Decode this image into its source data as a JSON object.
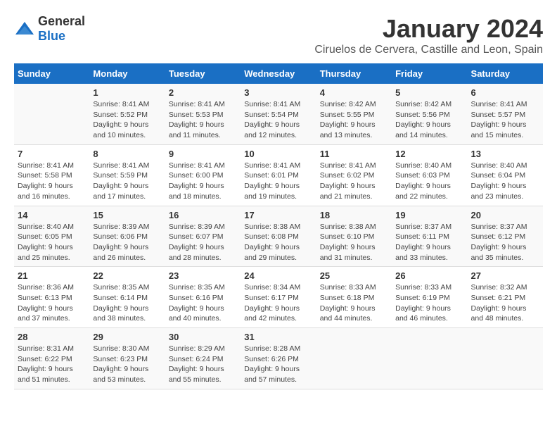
{
  "header": {
    "logo_general": "General",
    "logo_blue": "Blue",
    "month_title": "January 2024",
    "location": "Ciruelos de Cervera, Castille and Leon, Spain"
  },
  "weekdays": [
    "Sunday",
    "Monday",
    "Tuesday",
    "Wednesday",
    "Thursday",
    "Friday",
    "Saturday"
  ],
  "weeks": [
    [
      {
        "day": "",
        "info": ""
      },
      {
        "day": "1",
        "info": "Sunrise: 8:41 AM\nSunset: 5:52 PM\nDaylight: 9 hours\nand 10 minutes."
      },
      {
        "day": "2",
        "info": "Sunrise: 8:41 AM\nSunset: 5:53 PM\nDaylight: 9 hours\nand 11 minutes."
      },
      {
        "day": "3",
        "info": "Sunrise: 8:41 AM\nSunset: 5:54 PM\nDaylight: 9 hours\nand 12 minutes."
      },
      {
        "day": "4",
        "info": "Sunrise: 8:42 AM\nSunset: 5:55 PM\nDaylight: 9 hours\nand 13 minutes."
      },
      {
        "day": "5",
        "info": "Sunrise: 8:42 AM\nSunset: 5:56 PM\nDaylight: 9 hours\nand 14 minutes."
      },
      {
        "day": "6",
        "info": "Sunrise: 8:41 AM\nSunset: 5:57 PM\nDaylight: 9 hours\nand 15 minutes."
      }
    ],
    [
      {
        "day": "7",
        "info": "Sunrise: 8:41 AM\nSunset: 5:58 PM\nDaylight: 9 hours\nand 16 minutes."
      },
      {
        "day": "8",
        "info": "Sunrise: 8:41 AM\nSunset: 5:59 PM\nDaylight: 9 hours\nand 17 minutes."
      },
      {
        "day": "9",
        "info": "Sunrise: 8:41 AM\nSunset: 6:00 PM\nDaylight: 9 hours\nand 18 minutes."
      },
      {
        "day": "10",
        "info": "Sunrise: 8:41 AM\nSunset: 6:01 PM\nDaylight: 9 hours\nand 19 minutes."
      },
      {
        "day": "11",
        "info": "Sunrise: 8:41 AM\nSunset: 6:02 PM\nDaylight: 9 hours\nand 21 minutes."
      },
      {
        "day": "12",
        "info": "Sunrise: 8:40 AM\nSunset: 6:03 PM\nDaylight: 9 hours\nand 22 minutes."
      },
      {
        "day": "13",
        "info": "Sunrise: 8:40 AM\nSunset: 6:04 PM\nDaylight: 9 hours\nand 23 minutes."
      }
    ],
    [
      {
        "day": "14",
        "info": "Sunrise: 8:40 AM\nSunset: 6:05 PM\nDaylight: 9 hours\nand 25 minutes."
      },
      {
        "day": "15",
        "info": "Sunrise: 8:39 AM\nSunset: 6:06 PM\nDaylight: 9 hours\nand 26 minutes."
      },
      {
        "day": "16",
        "info": "Sunrise: 8:39 AM\nSunset: 6:07 PM\nDaylight: 9 hours\nand 28 minutes."
      },
      {
        "day": "17",
        "info": "Sunrise: 8:38 AM\nSunset: 6:08 PM\nDaylight: 9 hours\nand 29 minutes."
      },
      {
        "day": "18",
        "info": "Sunrise: 8:38 AM\nSunset: 6:10 PM\nDaylight: 9 hours\nand 31 minutes."
      },
      {
        "day": "19",
        "info": "Sunrise: 8:37 AM\nSunset: 6:11 PM\nDaylight: 9 hours\nand 33 minutes."
      },
      {
        "day": "20",
        "info": "Sunrise: 8:37 AM\nSunset: 6:12 PM\nDaylight: 9 hours\nand 35 minutes."
      }
    ],
    [
      {
        "day": "21",
        "info": "Sunrise: 8:36 AM\nSunset: 6:13 PM\nDaylight: 9 hours\nand 37 minutes."
      },
      {
        "day": "22",
        "info": "Sunrise: 8:35 AM\nSunset: 6:14 PM\nDaylight: 9 hours\nand 38 minutes."
      },
      {
        "day": "23",
        "info": "Sunrise: 8:35 AM\nSunset: 6:16 PM\nDaylight: 9 hours\nand 40 minutes."
      },
      {
        "day": "24",
        "info": "Sunrise: 8:34 AM\nSunset: 6:17 PM\nDaylight: 9 hours\nand 42 minutes."
      },
      {
        "day": "25",
        "info": "Sunrise: 8:33 AM\nSunset: 6:18 PM\nDaylight: 9 hours\nand 44 minutes."
      },
      {
        "day": "26",
        "info": "Sunrise: 8:33 AM\nSunset: 6:19 PM\nDaylight: 9 hours\nand 46 minutes."
      },
      {
        "day": "27",
        "info": "Sunrise: 8:32 AM\nSunset: 6:21 PM\nDaylight: 9 hours\nand 48 minutes."
      }
    ],
    [
      {
        "day": "28",
        "info": "Sunrise: 8:31 AM\nSunset: 6:22 PM\nDaylight: 9 hours\nand 51 minutes."
      },
      {
        "day": "29",
        "info": "Sunrise: 8:30 AM\nSunset: 6:23 PM\nDaylight: 9 hours\nand 53 minutes."
      },
      {
        "day": "30",
        "info": "Sunrise: 8:29 AM\nSunset: 6:24 PM\nDaylight: 9 hours\nand 55 minutes."
      },
      {
        "day": "31",
        "info": "Sunrise: 8:28 AM\nSunset: 6:26 PM\nDaylight: 9 hours\nand 57 minutes."
      },
      {
        "day": "",
        "info": ""
      },
      {
        "day": "",
        "info": ""
      },
      {
        "day": "",
        "info": ""
      }
    ]
  ]
}
